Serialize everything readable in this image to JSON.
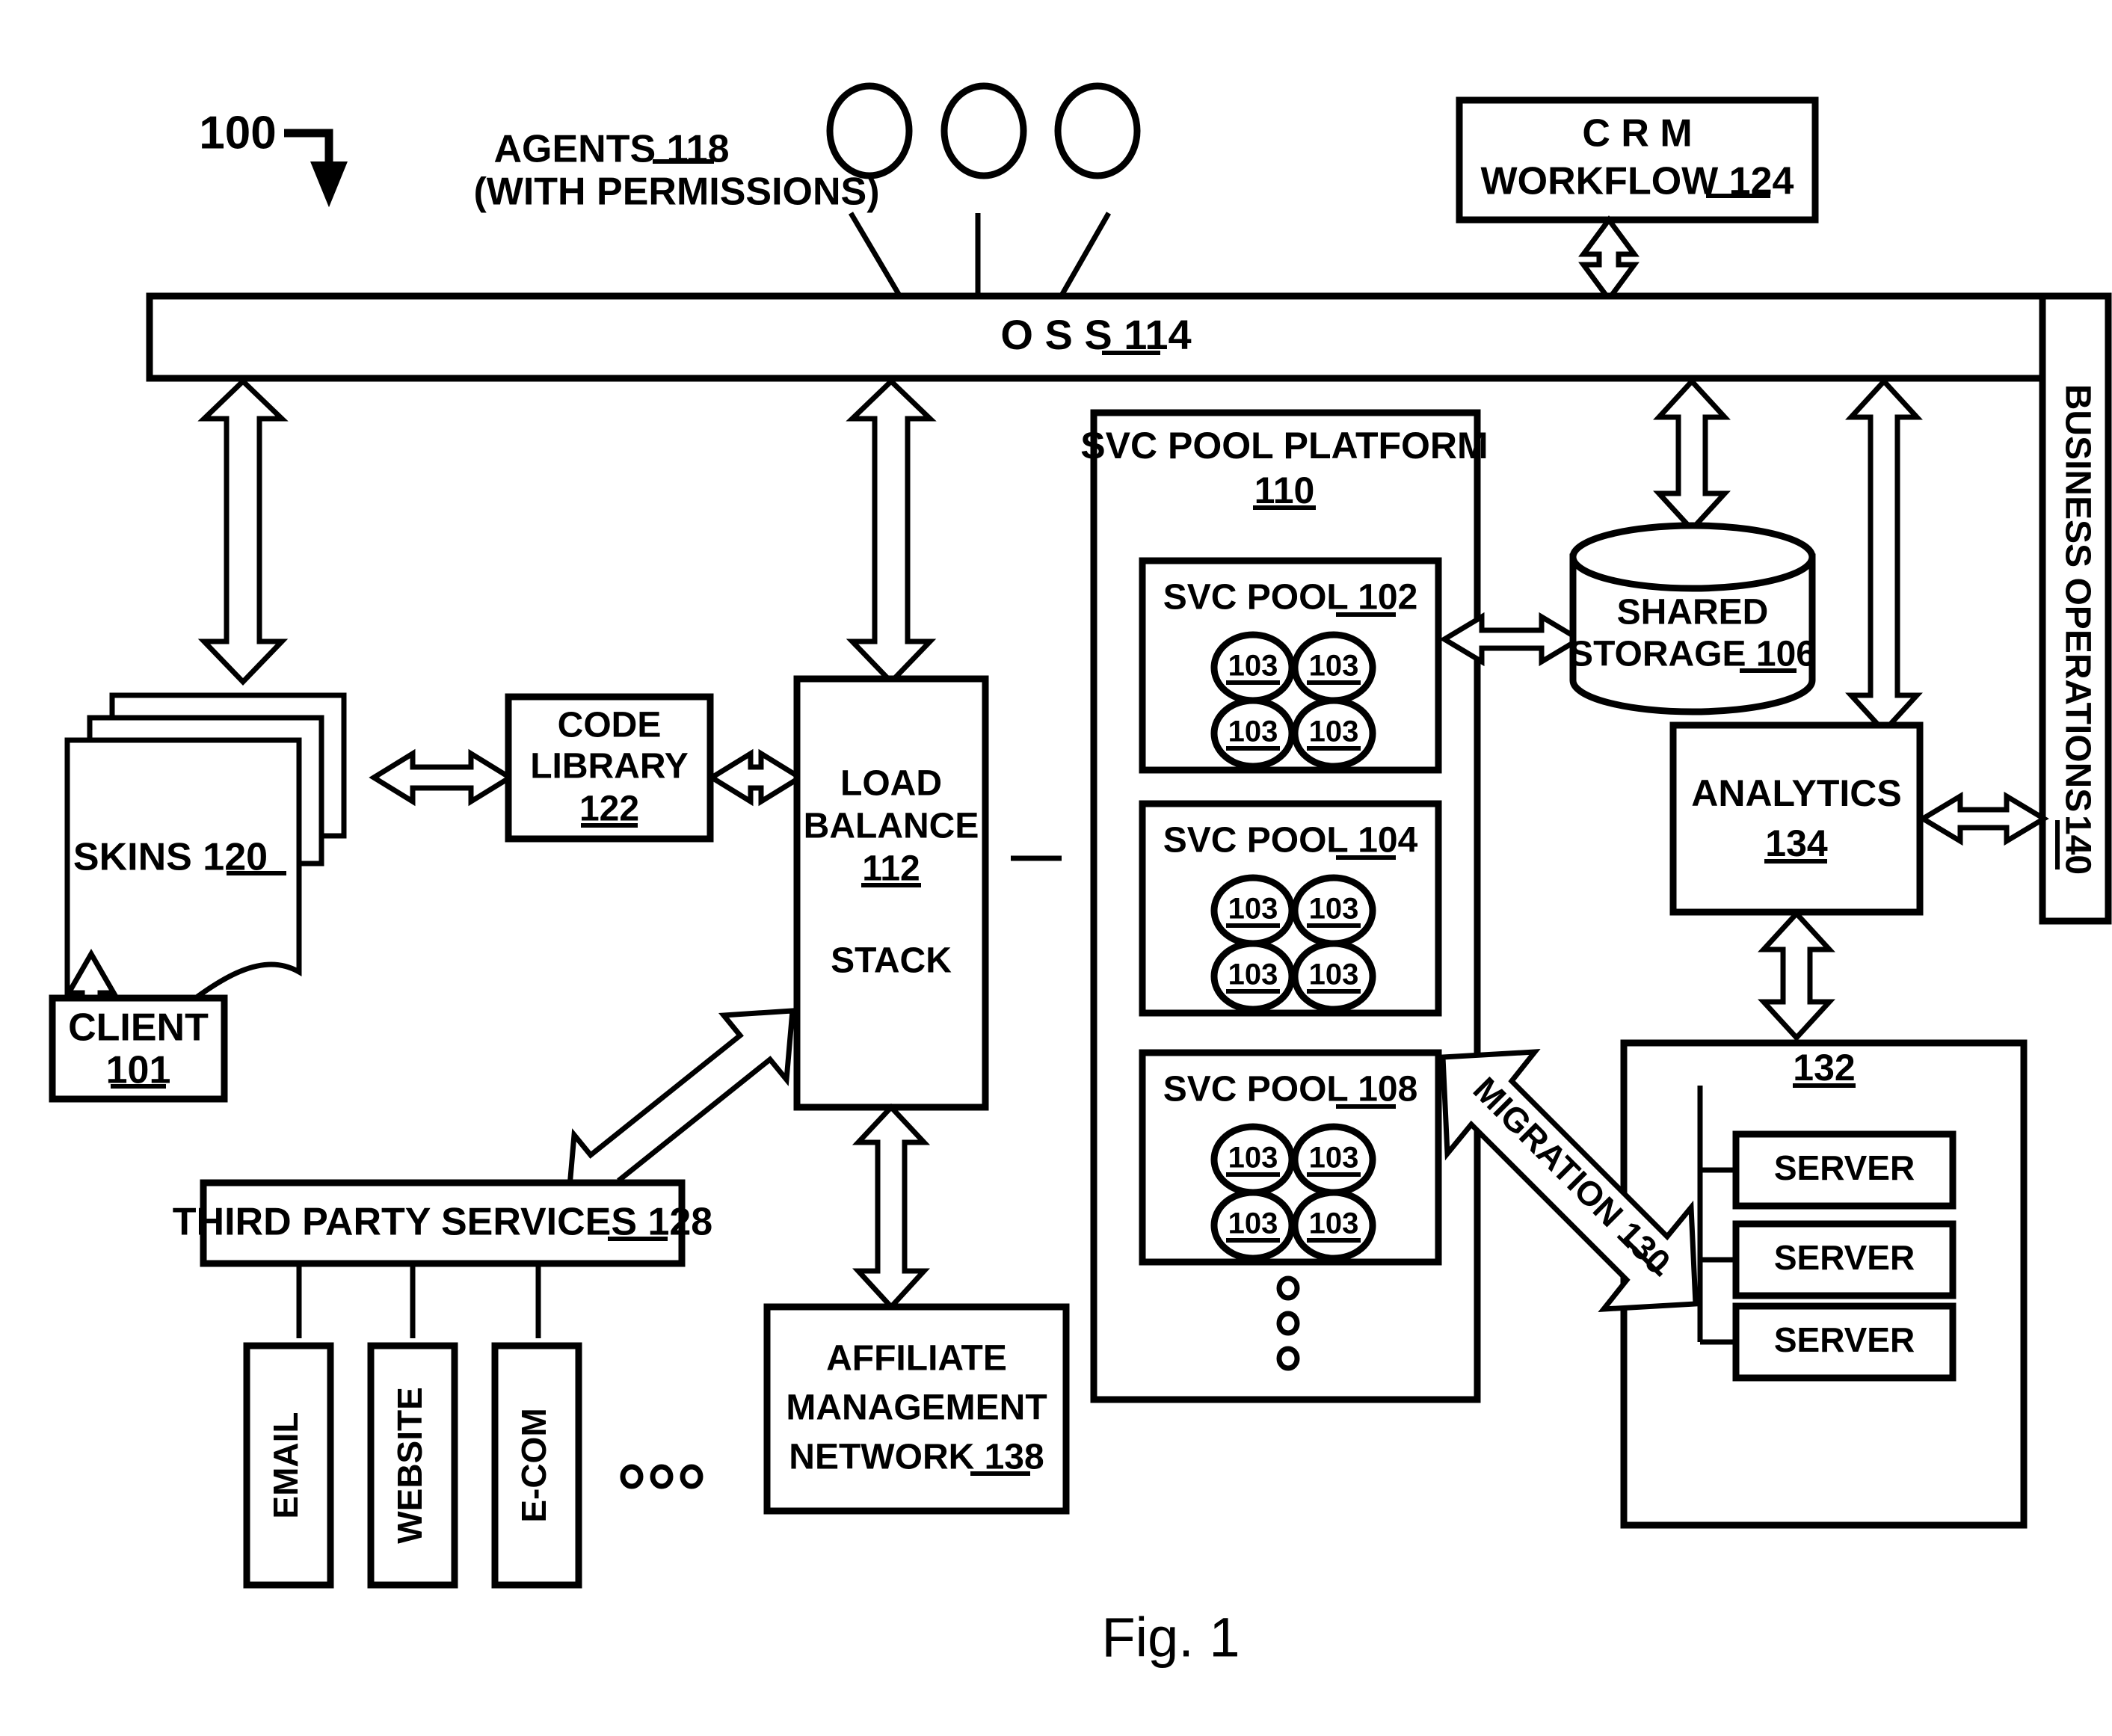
{
  "figure": {
    "caption": "Fig. 1",
    "system_ref": "100"
  },
  "nodes": {
    "agents": {
      "line1": "AGENTS 118",
      "line2": "(WITH PERMISSIONS)",
      "label_text": "AGENTS",
      "ref": "118",
      "count": 3
    },
    "crm": {
      "line1": "C R M",
      "line2": "WORKFLOW 124",
      "label_text": "WORKFLOW",
      "ref": "124"
    },
    "oss": {
      "label": "O S S 114",
      "label_text": "O S S",
      "ref": "114"
    },
    "business_operations": {
      "label_text": "BUSINESS OPERATIONS",
      "ref": "140",
      "full": "BUSINESS OPERATIONS 140"
    },
    "skins": {
      "label_text": "SKINS",
      "ref": "120",
      "full": "SKINS 120"
    },
    "client": {
      "line1": "CLIENT",
      "line2": "101",
      "ref": "101"
    },
    "code_library": {
      "line1": "CODE",
      "line2": "LIBRARY",
      "line3": "122",
      "ref": "122"
    },
    "load_balance": {
      "line1": "LOAD",
      "line2": "BALANCE",
      "line3": "112",
      "line4": "STACK",
      "ref": "112"
    },
    "third_party_services": {
      "label_text": "THIRD PARTY SERVICES",
      "ref": "128",
      "full": "THIRD PARTY SERVICES 128",
      "children": [
        "EMAIL",
        "WEBSITE",
        "E-COM"
      ],
      "ellipsis": "• • •"
    },
    "affiliate_network": {
      "line1": "AFFILIATE",
      "line2": "MANAGEMENT",
      "line3": "NETWORK 138",
      "line3_text": "NETWORK",
      "ref": "138"
    },
    "svc_pool_platform": {
      "line1": "SVC POOL PLATFORM",
      "line2": "110",
      "ref": "110"
    },
    "svc_pools": [
      {
        "label_text": "SVC POOL",
        "ref": "102",
        "full": "SVC POOL 102",
        "nodes": [
          "103",
          "103",
          "103",
          "103"
        ]
      },
      {
        "label_text": "SVC POOL",
        "ref": "104",
        "full": "SVC POOL 104",
        "nodes": [
          "103",
          "103",
          "103",
          "103"
        ]
      },
      {
        "label_text": "SVC POOL",
        "ref": "108",
        "full": "SVC POOL 108",
        "nodes": [
          "103",
          "103",
          "103",
          "103"
        ]
      }
    ],
    "pool_ellipsis": "⋮",
    "shared_storage": {
      "line1": "SHARED",
      "line2": "STORAGE 106",
      "line2_text": "STORAGE",
      "ref": "106"
    },
    "analytics": {
      "line1": "ANALYTICS",
      "line2": "134",
      "ref": "134"
    },
    "server_group": {
      "ref": "132",
      "servers": [
        "SERVER",
        "SERVER",
        "SERVER"
      ]
    },
    "migration": {
      "label_text": "MIGRATION",
      "ref": "130",
      "full": "MIGRATION 130"
    }
  },
  "colors": {
    "stroke": "#000000",
    "fill": "#ffffff",
    "background": "#ffffff"
  }
}
